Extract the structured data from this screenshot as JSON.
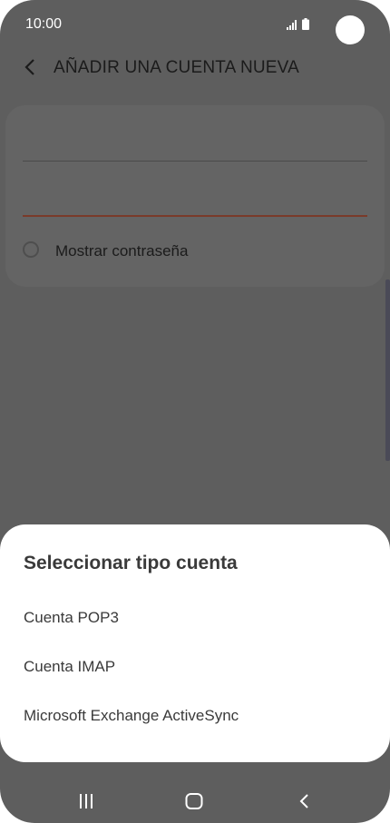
{
  "status_bar": {
    "time": "10:00"
  },
  "header": {
    "title": "AÑADIR UNA CUENTA NUEVA"
  },
  "form": {
    "show_password_label": "Mostrar contraseña"
  },
  "sheet": {
    "title": "Seleccionar tipo cuenta",
    "options": [
      {
        "label": "Cuenta POP3"
      },
      {
        "label": "Cuenta IMAP"
      },
      {
        "label": "Microsoft Exchange ActiveSync"
      }
    ]
  },
  "icons": {
    "back": "chevron-left-icon",
    "recents": "recents-icon",
    "home": "home-icon",
    "nav_back": "nav-back-icon"
  },
  "colors": {
    "overlay": "#5e5e5e",
    "sheet_bg": "#ffffff",
    "accent_line": "#7a3b2a"
  }
}
